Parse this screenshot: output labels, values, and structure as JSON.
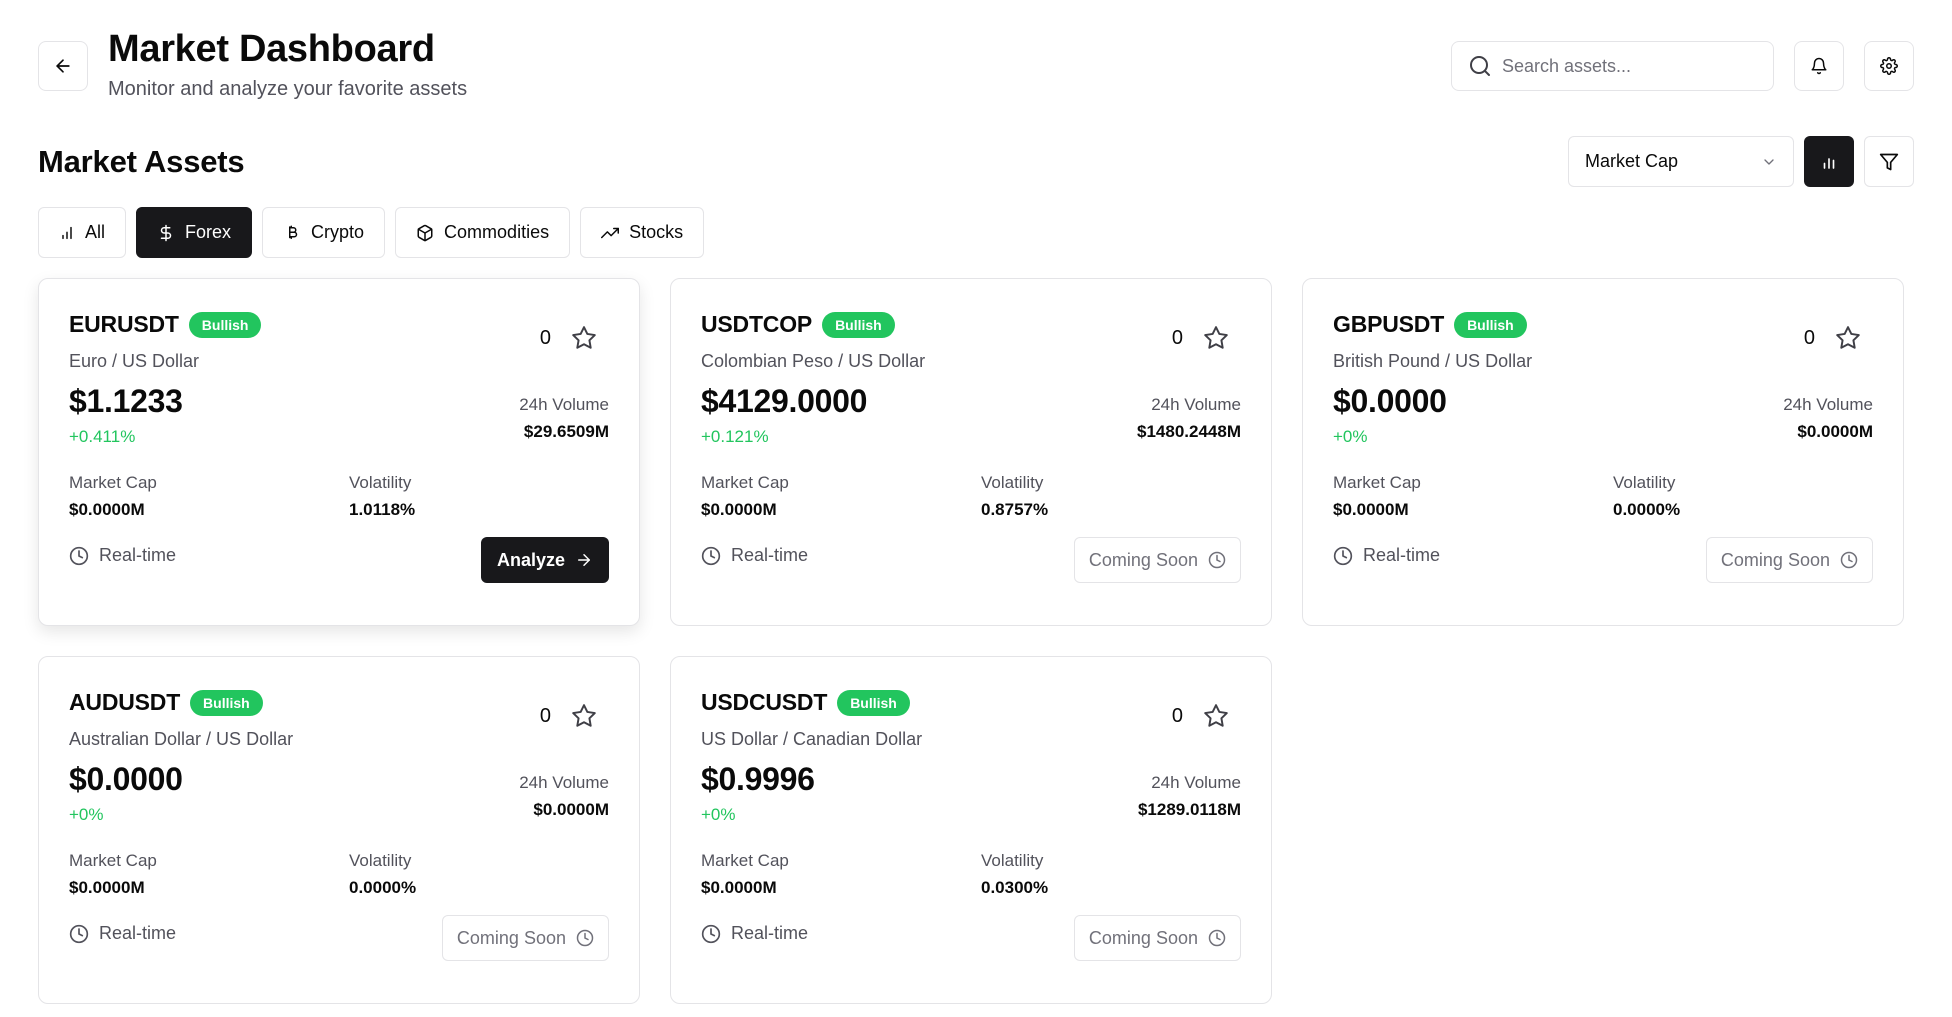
{
  "header": {
    "title": "Market Dashboard",
    "subtitle": "Monitor and analyze your favorite assets",
    "search_placeholder": "Search assets..."
  },
  "section": {
    "title": "Market Assets",
    "sort_selected": "Market Cap"
  },
  "tabs": [
    {
      "label": "All",
      "icon": "bar-chart-icon",
      "active": false
    },
    {
      "label": "Forex",
      "icon": "dollar-icon",
      "active": true
    },
    {
      "label": "Crypto",
      "icon": "bitcoin-icon",
      "active": false
    },
    {
      "label": "Commodities",
      "icon": "box-icon",
      "active": false
    },
    {
      "label": "Stocks",
      "icon": "trending-up-icon",
      "active": false
    }
  ],
  "colors": {
    "accent": "#18181b",
    "bullish": "#22c55e",
    "border": "#e4e4e7",
    "muted_text": "#52525b"
  },
  "cards": [
    {
      "symbol": "EURUSDT",
      "badge": "Bullish",
      "name": "Euro / US Dollar",
      "watch_count": "0",
      "price": "$1.1233",
      "change": "+0.411%",
      "volume_label": "24h Volume",
      "volume": "$29.6509M",
      "market_cap_label": "Market Cap",
      "market_cap": "$0.0000M",
      "volatility_label": "Volatility",
      "volatility": "1.0118%",
      "realtime_label": "Real-time",
      "action_label": "Analyze",
      "action_type": "analyze"
    },
    {
      "symbol": "USDTCOP",
      "badge": "Bullish",
      "name": "Colombian Peso / US Dollar",
      "watch_count": "0",
      "price": "$4129.0000",
      "change": "+0.121%",
      "volume_label": "24h Volume",
      "volume": "$1480.2448M",
      "market_cap_label": "Market Cap",
      "market_cap": "$0.0000M",
      "volatility_label": "Volatility",
      "volatility": "0.8757%",
      "realtime_label": "Real-time",
      "action_label": "Coming Soon",
      "action_type": "soon"
    },
    {
      "symbol": "GBPUSDT",
      "badge": "Bullish",
      "name": "British Pound / US Dollar",
      "watch_count": "0",
      "price": "$0.0000",
      "change": "+0%",
      "volume_label": "24h Volume",
      "volume": "$0.0000M",
      "market_cap_label": "Market Cap",
      "market_cap": "$0.0000M",
      "volatility_label": "Volatility",
      "volatility": "0.0000%",
      "realtime_label": "Real-time",
      "action_label": "Coming Soon",
      "action_type": "soon"
    },
    {
      "symbol": "AUDUSDT",
      "badge": "Bullish",
      "name": "Australian Dollar / US Dollar",
      "watch_count": "0",
      "price": "$0.0000",
      "change": "+0%",
      "volume_label": "24h Volume",
      "volume": "$0.0000M",
      "market_cap_label": "Market Cap",
      "market_cap": "$0.0000M",
      "volatility_label": "Volatility",
      "volatility": "0.0000%",
      "realtime_label": "Real-time",
      "action_label": "Coming Soon",
      "action_type": "soon"
    },
    {
      "symbol": "USDCUSDT",
      "badge": "Bullish",
      "name": "US Dollar / Canadian Dollar",
      "watch_count": "0",
      "price": "$0.9996",
      "change": "+0%",
      "volume_label": "24h Volume",
      "volume": "$1289.0118M",
      "market_cap_label": "Market Cap",
      "market_cap": "$0.0000M",
      "volatility_label": "Volatility",
      "volatility": "0.0300%",
      "realtime_label": "Real-time",
      "action_label": "Coming Soon",
      "action_type": "soon"
    }
  ]
}
